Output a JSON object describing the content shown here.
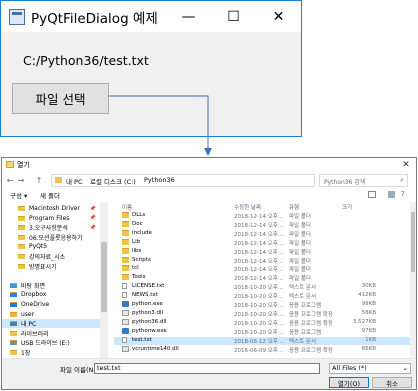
{
  "main_window": {
    "title": "PyQtFileDialog 예제",
    "path_label": "C:/Python36/test.txt",
    "button_label": "파일 선택",
    "minimize": "—",
    "maximize": "☐",
    "close": "✕"
  },
  "dialog": {
    "title": "열기",
    "close": "✕",
    "nav_back": "←",
    "nav_forward": "→",
    "nav_up": "↑",
    "breadcrumb": [
      "내 PC",
      "로컬 디스크 (C:)",
      "Python36"
    ],
    "search_placeholder": "Python36 검색",
    "organize": "구성 ▾",
    "new_folder": "새 폴더",
    "columns": {
      "name": "이름",
      "date": "수정한 날짜",
      "type": "유형",
      "size": "크기"
    },
    "nav_items": [
      {
        "label": "Macintosh Driver",
        "pinned": true,
        "kind": "folder"
      },
      {
        "label": "Program Files",
        "pinned": true,
        "kind": "folder"
      },
      {
        "label": "3.오구사항분석",
        "pinned": true,
        "kind": "folder"
      },
      {
        "label": "06.모션플롯응용하기",
        "pinned": false,
        "kind": "folder"
      },
      {
        "label": "PyQt5",
        "pinned": false,
        "kind": "folder"
      },
      {
        "label": "강의자료_시소",
        "pinned": false,
        "kind": "folder"
      },
      {
        "label": "방명표시기",
        "pinned": false,
        "kind": "folder"
      },
      {
        "label": "",
        "pinned": false,
        "kind": "spacer"
      },
      {
        "label": "바탕 화면",
        "pinned": false,
        "kind": "desktop"
      },
      {
        "label": "Dropbox",
        "pinned": false,
        "kind": "dropbox"
      },
      {
        "label": "OneDrive",
        "pinned": false,
        "kind": "onedrive"
      },
      {
        "label": "user",
        "pinned": false,
        "kind": "user"
      },
      {
        "label": "내 PC",
        "pinned": false,
        "kind": "pc",
        "selected": true
      },
      {
        "label": "라이브러리",
        "pinned": false,
        "kind": "lib"
      },
      {
        "label": "USB 드라이브 (E:)",
        "pinned": false,
        "kind": "usb"
      },
      {
        "label": "1장",
        "pinned": false,
        "kind": "folder"
      }
    ],
    "files": [
      {
        "name": "DLLs",
        "date": "2018-12-14 오후...",
        "type": "파일 폴더",
        "size": "",
        "kind": "folder"
      },
      {
        "name": "Doc",
        "date": "2018-12-14 오후...",
        "type": "파일 폴더",
        "size": "",
        "kind": "folder"
      },
      {
        "name": "include",
        "date": "2018-12-14 오후...",
        "type": "파일 폴더",
        "size": "",
        "kind": "folder"
      },
      {
        "name": "Lib",
        "date": "2018-12-14 오후...",
        "type": "파일 폴더",
        "size": "",
        "kind": "folder"
      },
      {
        "name": "libs",
        "date": "2018-12-14 오후...",
        "type": "파일 폴더",
        "size": "",
        "kind": "folder"
      },
      {
        "name": "Scripts",
        "date": "2018-12-14 오후...",
        "type": "파일 폴더",
        "size": "",
        "kind": "folder"
      },
      {
        "name": "tcl",
        "date": "2018-12-14 오후...",
        "type": "파일 폴더",
        "size": "",
        "kind": "folder"
      },
      {
        "name": "Tools",
        "date": "2018-12-14 오후...",
        "type": "파일 폴더",
        "size": "",
        "kind": "folder"
      },
      {
        "name": "LICENSE.txt",
        "date": "2018-10-20 오후...",
        "type": "텍스트 문서",
        "size": "30KB",
        "kind": "file"
      },
      {
        "name": "NEWS.txt",
        "date": "2018-10-20 오후...",
        "type": "텍스트 문서",
        "size": "412KB",
        "kind": "file"
      },
      {
        "name": "python.exe",
        "date": "2018-10-20 오후...",
        "type": "응용 프로그램",
        "size": "99KB",
        "kind": "py"
      },
      {
        "name": "python3.dll",
        "date": "2018-10-20 오후...",
        "type": "응용 프로그램 확장",
        "size": "58KB",
        "kind": "dll"
      },
      {
        "name": "python36.dll",
        "date": "2018-10-20 오후...",
        "type": "응용 프로그램 확장",
        "size": "3,527KB",
        "kind": "dll"
      },
      {
        "name": "pythonw.exe",
        "date": "2018-10-20 오후...",
        "type": "응용 프로그램",
        "size": "97KB",
        "kind": "py"
      },
      {
        "name": "test.txt",
        "date": "2018-06-12 오후...",
        "type": "텍스트 문서",
        "size": "1KB",
        "kind": "file",
        "selected": true
      },
      {
        "name": "vcruntime140.dll",
        "date": "2016-06-09 오후...",
        "type": "응용 프로그램 확장",
        "size": "86KB",
        "kind": "dll"
      }
    ],
    "filename_label": "파일 이름(N):",
    "filename_value": "test.txt",
    "filetype_value": "All Files (*)",
    "open_button": "열기(O)",
    "cancel_button": "취소"
  },
  "colors": {
    "accent": "#0078d7",
    "window_border": "#1c7fd6",
    "selection": "#cce8ff",
    "folder": "#f0c24a"
  }
}
